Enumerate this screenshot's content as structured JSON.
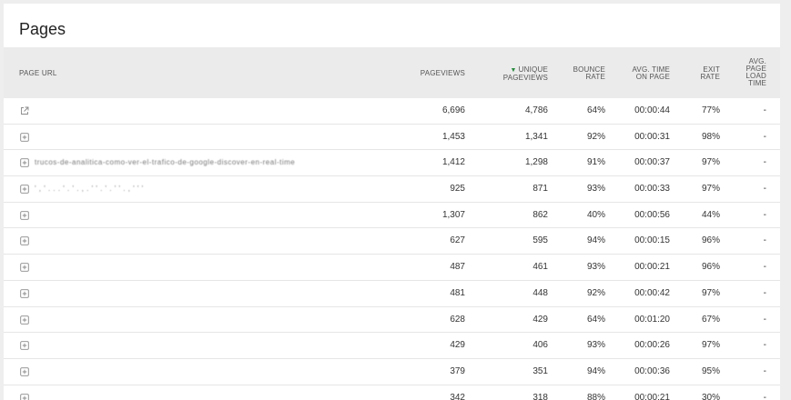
{
  "title": "Pages",
  "columns": {
    "page_url": "PAGE URL",
    "pageviews": "PAGEVIEWS",
    "unique_pageviews": [
      "UNIQUE",
      "PAGEVIEWS"
    ],
    "bounce_rate": [
      "BOUNCE",
      "RATE"
    ],
    "avg_time": [
      "AVG. TIME",
      "ON PAGE"
    ],
    "exit_rate": [
      "EXIT",
      "RATE"
    ],
    "avg_load": [
      "AVG.",
      "PAGE",
      "LOAD",
      "TIME"
    ],
    "sort_indicator": "▼"
  },
  "rows": [
    {
      "icon": "external-link-icon",
      "url": "",
      "pageviews": "6,696",
      "unique": "4,786",
      "bounce": "64%",
      "time": "00:00:44",
      "exit": "77%",
      "load": "-"
    },
    {
      "icon": "expand-plus-icon",
      "url": "",
      "pageviews": "1,453",
      "unique": "1,341",
      "bounce": "92%",
      "time": "00:00:31",
      "exit": "98%",
      "load": "-"
    },
    {
      "icon": "expand-plus-icon",
      "url": "trucos-de-analitica-como-ver-el-trafico-de-google-discover-en-real-time",
      "pageviews": "1,412",
      "unique": "1,298",
      "bounce": "91%",
      "time": "00:00:37",
      "exit": "97%",
      "load": "-"
    },
    {
      "icon": "expand-plus-icon",
      "url": "' , ' . . . ' . ' . , . ' ' . ' . ' ' . , ' ' '",
      "pageviews": "925",
      "unique": "871",
      "bounce": "93%",
      "time": "00:00:33",
      "exit": "97%",
      "load": "-"
    },
    {
      "icon": "expand-plus-icon",
      "url": "",
      "pageviews": "1,307",
      "unique": "862",
      "bounce": "40%",
      "time": "00:00:56",
      "exit": "44%",
      "load": "-"
    },
    {
      "icon": "expand-plus-icon",
      "url": "",
      "pageviews": "627",
      "unique": "595",
      "bounce": "94%",
      "time": "00:00:15",
      "exit": "96%",
      "load": "-"
    },
    {
      "icon": "expand-plus-icon",
      "url": "",
      "pageviews": "487",
      "unique": "461",
      "bounce": "93%",
      "time": "00:00:21",
      "exit": "96%",
      "load": "-"
    },
    {
      "icon": "expand-plus-icon",
      "url": "",
      "pageviews": "481",
      "unique": "448",
      "bounce": "92%",
      "time": "00:00:42",
      "exit": "97%",
      "load": "-"
    },
    {
      "icon": "expand-plus-icon",
      "url": "",
      "pageviews": "628",
      "unique": "429",
      "bounce": "64%",
      "time": "00:01:20",
      "exit": "67%",
      "load": "-"
    },
    {
      "icon": "expand-plus-icon",
      "url": "",
      "pageviews": "429",
      "unique": "406",
      "bounce": "93%",
      "time": "00:00:26",
      "exit": "97%",
      "load": "-"
    },
    {
      "icon": "expand-plus-icon",
      "url": "",
      "pageviews": "379",
      "unique": "351",
      "bounce": "94%",
      "time": "00:00:36",
      "exit": "95%",
      "load": "-"
    },
    {
      "icon": "expand-plus-icon",
      "url": "",
      "pageviews": "342",
      "unique": "318",
      "bounce": "88%",
      "time": "00:00:21",
      "exit": "30%",
      "load": "-"
    }
  ]
}
